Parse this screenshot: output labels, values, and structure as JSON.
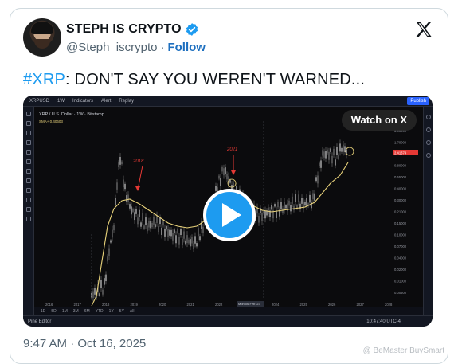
{
  "author": {
    "display_name": "STEPH IS CRYPTO",
    "handle": "@Steph_iscrypto",
    "separator": "·",
    "follow_label": "Follow"
  },
  "tweet": {
    "hashtag": "#XRP",
    "text": ": DON'T SAY YOU WEREN'T WARNED...",
    "timestamp": "9:47 AM · Oct 16, 2025"
  },
  "media": {
    "watch_label": "Watch on X",
    "tv_symbol": "XRPUSD",
    "tv_interval": "1W",
    "tv_indicators": "Indicators",
    "tv_alert": "Alert",
    "tv_replay": "Replay",
    "tv_publish": "Publish",
    "chart_title": "XRP / U.S. Dollar · 1W · Bitstamp",
    "chart_sub": "SMA+ 0.40603",
    "annotation_2018": "2018",
    "annotation_2021": "2021",
    "timeframes": [
      "1D",
      "5D",
      "1M",
      "3M",
      "6M",
      "YTD",
      "1Y",
      "5Y",
      "All"
    ],
    "bottom_label": "Pine Editor",
    "clock": "10:47:40 UTC-4",
    "x_ticks": [
      "2016",
      "2017",
      "2018",
      "2019",
      "2020",
      "2021",
      "2022",
      "2023",
      "2024",
      "2025",
      "2026",
      "2027",
      "2028"
    ],
    "y_ticks": [
      "3.00000",
      "1.70000",
      "1.20000",
      "0.80000",
      "0.55000",
      "0.40000",
      "0.30000",
      "0.21000",
      "0.15000",
      "0.10000",
      "0.07000",
      "0.04000",
      "0.02000",
      "0.01000",
      "0.00500"
    ],
    "price_tag": "2.41374",
    "date_tag": "Mon 06 Feb '23"
  },
  "watermark": "@ BeMaster BuySmart",
  "colors": {
    "hashtag": "#1d9bf0",
    "play": "#1d9bf0",
    "sma": "#e8d27a",
    "candles": "#c9c9c9",
    "annotation": "#e53935"
  }
}
